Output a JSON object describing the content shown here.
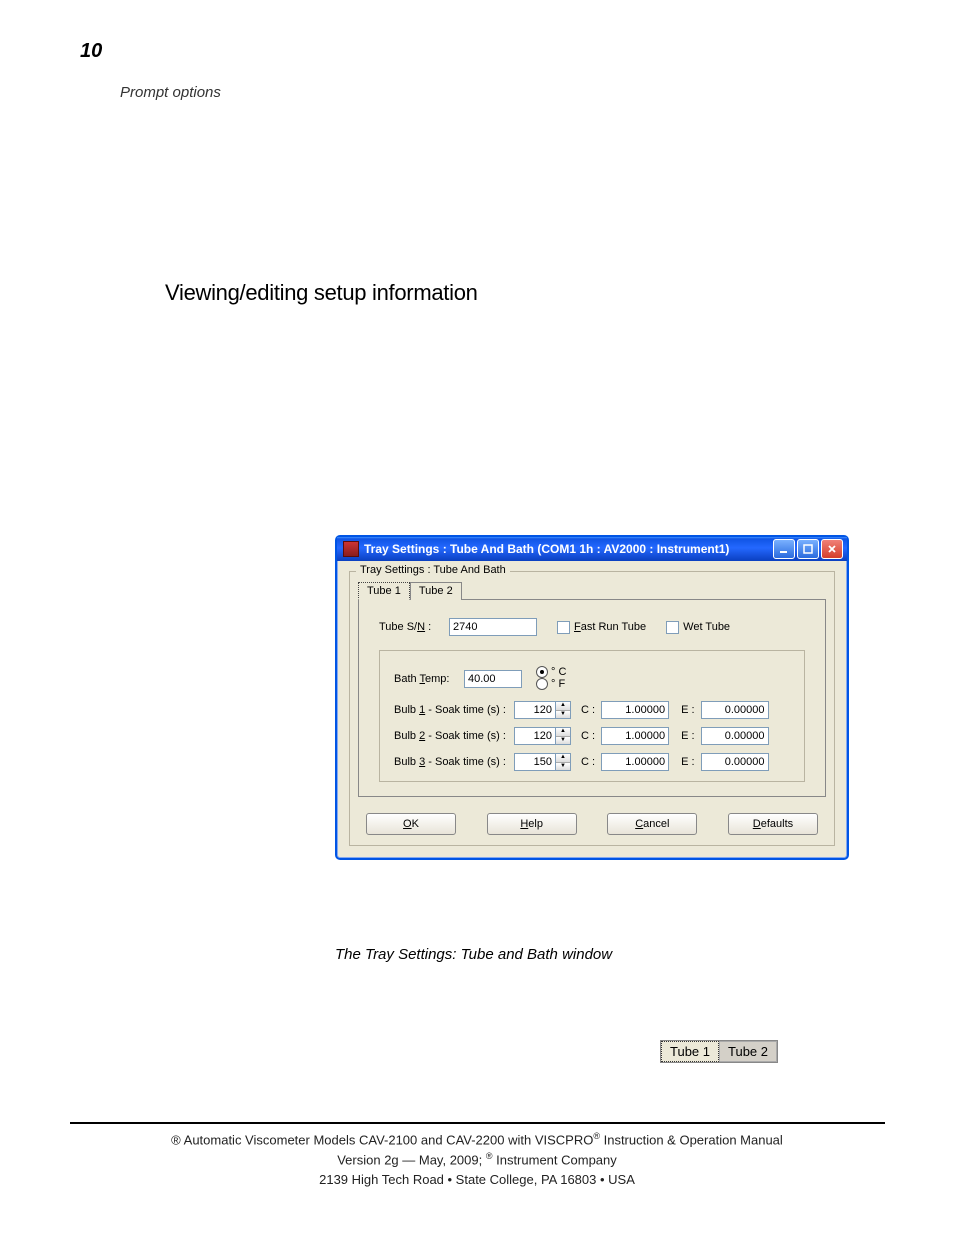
{
  "page_number": "10",
  "running_head": "Prompt options",
  "section_heading": "Viewing/editing setup information",
  "figure_caption": "The Tray Settings: Tube and Bath window",
  "mini_tabs": {
    "tab1": "Tube 1",
    "tab2": "Tube 2"
  },
  "footer": {
    "line1_prefix": "® Automatic Viscometer Models CAV-2100 and CAV-2200 with VISCPRO",
    "line1_suffix": " Instruction & Operation Manual",
    "line2_prefix": "Version 2g — May, 2009; ",
    "line2_suffix": " Instrument Company",
    "line3": "2139 High Tech Road • State College, PA  16803 • USA"
  },
  "dialog": {
    "title": "Tray Settings : Tube And Bath (COM1 1h : AV2000 : Instrument1)",
    "group_legend": "Tray Settings : Tube And Bath",
    "tabs": {
      "tube1": "Tube 1",
      "tube2": "Tube 2"
    },
    "tube_sn_label": "Tube S/N :",
    "tube_sn_value": "2740",
    "fast_run_label": "Fast Run Tube",
    "wet_tube_label": "Wet Tube",
    "bath_temp_label": "Bath Temp:",
    "bath_temp_value": "40.00",
    "unit_c": "° C",
    "unit_f": "° F",
    "bulbs": [
      {
        "label": "Bulb 1 -  Soak time (s) :",
        "soak": "120",
        "c": "1.00000",
        "e": "0.00000"
      },
      {
        "label": "Bulb 2 -  Soak time (s) :",
        "soak": "120",
        "c": "1.00000",
        "e": "0.00000"
      },
      {
        "label": "Bulb 3 -  Soak time (s) :",
        "soak": "150",
        "c": "1.00000",
        "e": "0.00000"
      }
    ],
    "c_label": "C :",
    "e_label": "E :",
    "buttons": {
      "ok": "OK",
      "help": "Help",
      "cancel": "Cancel",
      "defaults": "Defaults"
    }
  }
}
